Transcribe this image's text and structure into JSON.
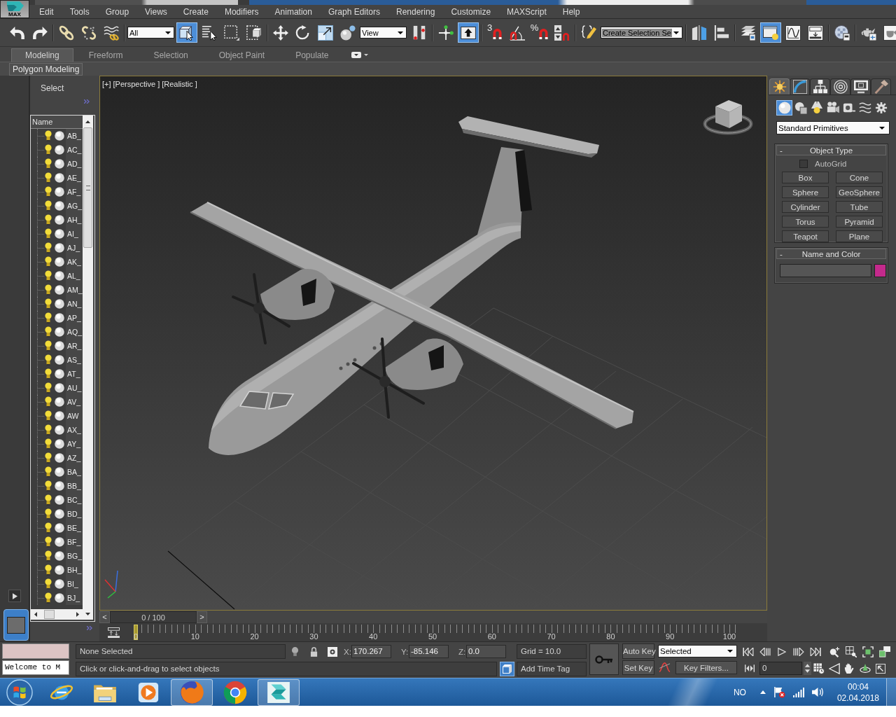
{
  "app_button": {
    "label": "MAX"
  },
  "menu_bar": [
    "Edit",
    "Tools",
    "Group",
    "Views",
    "Create",
    "Modifiers",
    "Animation",
    "Graph Editors",
    "Rendering",
    "Customize",
    "MAXScript",
    "Help"
  ],
  "main_toolbar": [
    [
      {
        "kind": "button",
        "selected": false
      },
      {
        "kind": "button",
        "selected": false
      }
    ],
    [
      {
        "kind": "button",
        "selected": false
      },
      {
        "kind": "button",
        "selected": false
      },
      {
        "kind": "button",
        "selected": false
      }
    ],
    [
      {
        "kind": "dropdown",
        "value": "All"
      },
      {
        "kind": "button",
        "selected": true
      },
      {
        "kind": "button",
        "selected": false
      },
      {
        "kind": "button",
        "selected": false
      },
      {
        "kind": "button",
        "selected": false
      }
    ],
    [
      {
        "kind": "button",
        "selected": false
      },
      {
        "kind": "button",
        "selected": false
      },
      {
        "kind": "button",
        "selected": false
      },
      {
        "kind": "button",
        "selected": false
      },
      {
        "kind": "dropdown",
        "value": "View"
      },
      {
        "kind": "button",
        "selected": false
      }
    ],
    [
      {
        "kind": "button",
        "selected": false
      },
      {
        "kind": "button",
        "selected": true
      }
    ],
    [
      {
        "kind": "button",
        "selected": false,
        "label": "3"
      },
      {
        "kind": "button",
        "selected": false
      },
      {
        "kind": "button",
        "selected": false,
        "label": "%"
      },
      {
        "kind": "button",
        "selected": false
      }
    ],
    [
      {
        "kind": "button",
        "selected": false
      },
      {
        "kind": "combo",
        "value": "Create Selection Se"
      }
    ],
    [
      {
        "kind": "button",
        "selected": false
      },
      {
        "kind": "button",
        "selected": false
      }
    ],
    [
      {
        "kind": "button",
        "selected": false
      },
      {
        "kind": "button",
        "selected": true
      },
      {
        "kind": "button",
        "selected": false
      },
      {
        "kind": "button",
        "selected": false
      }
    ],
    [
      {
        "kind": "button",
        "selected": false
      }
    ],
    [
      {
        "kind": "button",
        "selected": false
      },
      {
        "kind": "button",
        "selected": false
      }
    ]
  ],
  "ribbon": {
    "tabs": [
      {
        "label": "Modeling",
        "selected": true
      },
      {
        "label": "Freeform",
        "selected": false
      },
      {
        "label": "Selection",
        "selected": false
      },
      {
        "label": "Object Paint",
        "selected": false
      },
      {
        "label": "Populate",
        "selected": false
      }
    ],
    "panel": "Polygon Modeling"
  },
  "scene_explorer": {
    "title": "Select",
    "column": "Name",
    "items": [
      {
        "name": "AB_",
        "visible": true,
        "frozen": false
      },
      {
        "name": "AC_",
        "visible": true,
        "frozen": false
      },
      {
        "name": "AD_",
        "visible": true,
        "frozen": false
      },
      {
        "name": "AE_",
        "visible": true,
        "frozen": false
      },
      {
        "name": "AF_",
        "visible": true,
        "frozen": false
      },
      {
        "name": "AG_",
        "visible": true,
        "frozen": false
      },
      {
        "name": "AH_",
        "visible": true,
        "frozen": false
      },
      {
        "name": "AI_",
        "visible": true,
        "frozen": false
      },
      {
        "name": "AJ_",
        "visible": true,
        "frozen": false
      },
      {
        "name": "AK_",
        "visible": true,
        "frozen": false
      },
      {
        "name": "AL_",
        "visible": true,
        "frozen": false
      },
      {
        "name": "AM_",
        "visible": true,
        "frozen": false
      },
      {
        "name": "AN_",
        "visible": true,
        "frozen": false
      },
      {
        "name": "AP_",
        "visible": true,
        "frozen": false
      },
      {
        "name": "AQ_",
        "visible": true,
        "frozen": false
      },
      {
        "name": "AR_",
        "visible": true,
        "frozen": false
      },
      {
        "name": "AS_",
        "visible": true,
        "frozen": false
      },
      {
        "name": "AT_",
        "visible": true,
        "frozen": false
      },
      {
        "name": "AU_",
        "visible": true,
        "frozen": false
      },
      {
        "name": "AV_",
        "visible": true,
        "frozen": false
      },
      {
        "name": "AW",
        "visible": true,
        "frozen": false
      },
      {
        "name": "AX_",
        "visible": true,
        "frozen": false
      },
      {
        "name": "AY_",
        "visible": true,
        "frozen": false
      },
      {
        "name": "AZ_",
        "visible": true,
        "frozen": false
      },
      {
        "name": "BA_",
        "visible": true,
        "frozen": false
      },
      {
        "name": "BB_",
        "visible": true,
        "frozen": false
      },
      {
        "name": "BC_",
        "visible": true,
        "frozen": false
      },
      {
        "name": "BD_",
        "visible": true,
        "frozen": false
      },
      {
        "name": "BE_",
        "visible": true,
        "frozen": false
      },
      {
        "name": "BF_",
        "visible": true,
        "frozen": false
      },
      {
        "name": "BG_",
        "visible": true,
        "frozen": false
      },
      {
        "name": "BH_",
        "visible": true,
        "frozen": false
      },
      {
        "name": "BI_",
        "visible": true,
        "frozen": false
      },
      {
        "name": "BJ_",
        "visible": true,
        "frozen": false
      }
    ]
  },
  "viewport": {
    "labels": [
      "[+]",
      "[Perspective ]",
      "[Realistic ]"
    ]
  },
  "command_panel": {
    "tabs": [
      {
        "selected": true
      },
      {
        "selected": false
      },
      {
        "selected": false
      },
      {
        "selected": false
      },
      {
        "selected": false
      },
      {
        "selected": false
      }
    ],
    "categories": [
      {
        "selected": true
      },
      {
        "selected": false
      },
      {
        "selected": false
      },
      {
        "selected": false
      },
      {
        "selected": false
      },
      {
        "selected": false
      },
      {
        "selected": false
      }
    ],
    "dropdown": "Standard Primitives",
    "object_type": {
      "toggle": "-",
      "title": "Object Type",
      "autogrid": {
        "label": "AutoGrid",
        "checked": false
      },
      "buttons": [
        "Box",
        "Cone",
        "Sphere",
        "GeoSphere",
        "Cylinder",
        "Tube",
        "Torus",
        "Pyramid",
        "Teapot",
        "Plane"
      ]
    },
    "name_and_color": {
      "toggle": "-",
      "title": "Name and Color",
      "color": "#c42a8c"
    }
  },
  "time_slider": {
    "prev": "<",
    "label": "0 / 100",
    "next": ">",
    "level": 0
  },
  "track_bar": {
    "labels": [
      "0",
      "10",
      "20",
      "30",
      "40",
      "50",
      "60",
      "70",
      "80",
      "90",
      "100"
    ]
  },
  "listener": {
    "value": "Welcome to M"
  },
  "status": {
    "selection": "None Selected",
    "prompt": "Click or click-and-drag to select objects",
    "coordinates": [
      {
        "axis": "X:",
        "value": "170.267"
      },
      {
        "axis": "Y:",
        "value": "-85.146"
      },
      {
        "axis": "Z:",
        "value": "0.0"
      }
    ],
    "grid": "Grid = 10.0",
    "time_tag": "Add Time Tag"
  },
  "animation": {
    "auto_key": "Auto Key",
    "set_key": "Set Key",
    "key_mode": "Selected",
    "key_filters": "Key Filters...",
    "frame": "0"
  },
  "taskbar": {
    "apps": [
      {
        "running": false
      },
      {
        "running": false
      },
      {
        "running": false
      },
      {
        "running": true
      },
      {
        "running": false
      },
      {
        "running": true
      }
    ],
    "language": "NO",
    "time": "00:04",
    "date": "02.04.2018"
  }
}
